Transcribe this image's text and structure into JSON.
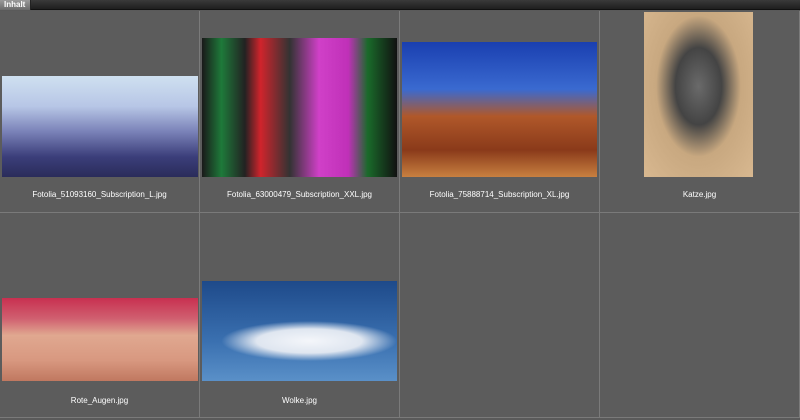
{
  "tab": {
    "label": "Inhalt"
  },
  "items": [
    {
      "name": "Fotolia_51093160_Subscription_L.jpg"
    },
    {
      "name": "Fotolia_63000479_Subscription_XXL.jpg"
    },
    {
      "name": "Fotolia_75888714_Subscription_XL.jpg"
    },
    {
      "name": "Katze.jpg"
    },
    {
      "name": "Rote_Augen.jpg"
    },
    {
      "name": "Wolke.jpg"
    }
  ]
}
